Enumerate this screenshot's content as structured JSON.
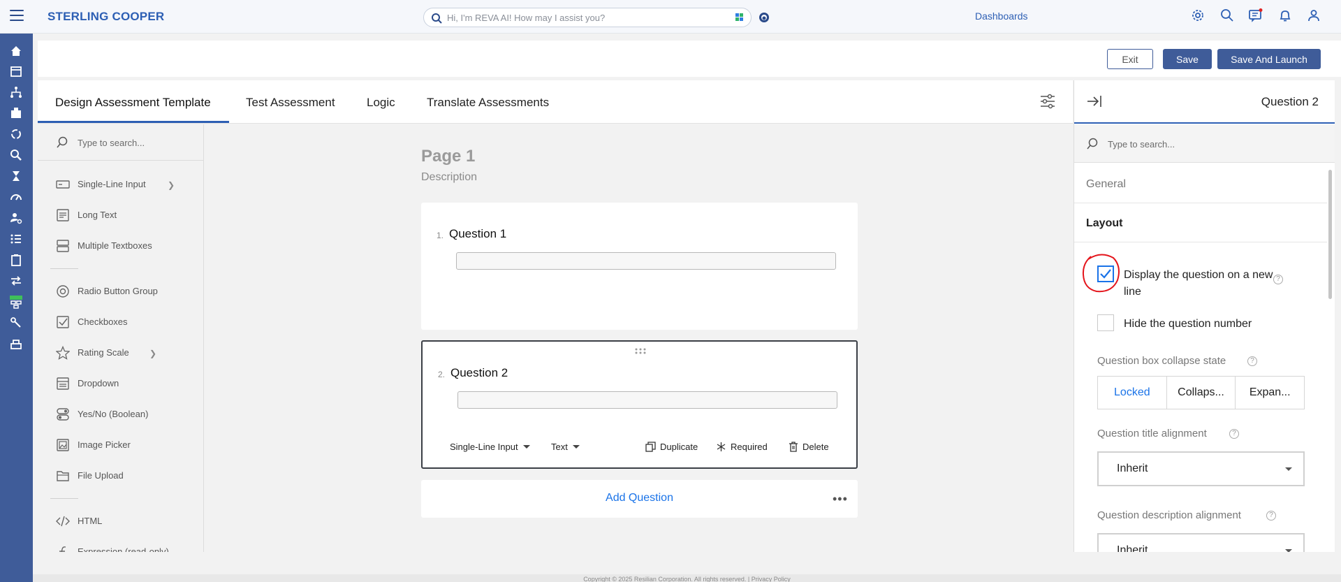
{
  "header": {
    "brand": "STERLING COOPER",
    "search_placeholder": "Hi, I'm REVA AI! How may I assist you?",
    "dashboards": "Dashboards",
    "accent": "#2d5fb4"
  },
  "actions": {
    "exit": "Exit",
    "save": "Save",
    "save_launch": "Save And Launch"
  },
  "tabs": [
    {
      "label": "Design Assessment Template"
    },
    {
      "label": "Test Assessment"
    },
    {
      "label": "Logic"
    },
    {
      "label": "Translate Assessments"
    }
  ],
  "toolbox": {
    "search_placeholder": "Type to search...",
    "items": [
      {
        "label": "Single-Line Input",
        "icon": "single-line-input-icon"
      },
      {
        "label": "Long Text",
        "icon": "long-text-icon"
      },
      {
        "label": "Multiple Textboxes",
        "icon": "multiple-textboxes-icon"
      },
      {
        "label": "Radio Button Group",
        "icon": "radio-button-icon"
      },
      {
        "label": "Checkboxes",
        "icon": "checkbox-icon"
      },
      {
        "label": "Rating Scale",
        "icon": "star-icon"
      },
      {
        "label": "Dropdown",
        "icon": "dropdown-icon"
      },
      {
        "label": "Yes/No (Boolean)",
        "icon": "toggle-icon"
      },
      {
        "label": "Image Picker",
        "icon": "image-icon"
      },
      {
        "label": "File Upload",
        "icon": "folder-icon"
      },
      {
        "label": "HTML",
        "icon": "code-icon"
      },
      {
        "label": "Expression (read-only)",
        "icon": "function-icon"
      }
    ]
  },
  "canvas": {
    "page_title": "Page 1",
    "page_description": "Description",
    "questions": [
      {
        "num": "1.",
        "title": "Question 1"
      },
      {
        "num": "2.",
        "title": "Question 2"
      }
    ],
    "q2_toolbar": {
      "type": "Single-Line Input",
      "input_type": "Text",
      "duplicate": "Duplicate",
      "required": "Required",
      "delete": "Delete"
    },
    "add_question": "Add Question"
  },
  "panel": {
    "question_name": "Question 2",
    "search_placeholder": "Type to search...",
    "sections": {
      "general": "General",
      "layout": "Layout"
    },
    "display_new_line": {
      "label": "Display the question on a new line",
      "checked": true
    },
    "hide_number": {
      "label": "Hide the question number",
      "checked": false
    },
    "collapse_state": {
      "label": "Question box collapse state",
      "options": [
        "Locked",
        "Collaps...",
        "Expan..."
      ],
      "selected": "Locked"
    },
    "title_alignment": {
      "label": "Question title alignment",
      "value": "Inherit"
    },
    "description_alignment": {
      "label": "Question description alignment",
      "value": "Inherit"
    }
  },
  "footer": {
    "text": "Copyright © 2025 Resilian Corporation. All rights reserved. | Privacy Policy"
  }
}
